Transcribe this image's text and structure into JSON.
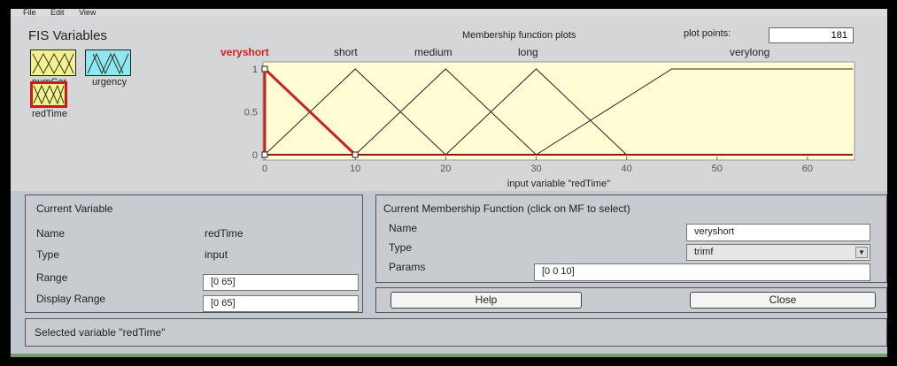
{
  "menu": [
    "File",
    "Edit",
    "View"
  ],
  "fis_variables": {
    "title": "FIS Variables",
    "inputs": [
      "numCar",
      "urgency"
    ],
    "output": "redTime"
  },
  "plot": {
    "title": "Membership function plots",
    "plot_points_label": "plot points:",
    "plot_points_value": "181",
    "xlabel": "input variable \"redTime\"",
    "x_ticks": [
      "0",
      "10",
      "20",
      "30",
      "40",
      "50",
      "60"
    ],
    "y_ticks": [
      "0",
      "0.5",
      "1"
    ],
    "mf_names": [
      "veryshort",
      "short",
      "medium",
      "long",
      "verylong"
    ],
    "selected_mf_color": "#cc2222"
  },
  "chart_data": {
    "type": "line",
    "xlabel": "input variable \"redTime\"",
    "xlim": [
      0,
      65
    ],
    "ylim": [
      0,
      1
    ],
    "series": [
      {
        "name": "veryshort",
        "x": [
          0,
          0,
          10
        ],
        "y": [
          0,
          1,
          0
        ],
        "color": "#cc2222"
      },
      {
        "name": "short",
        "x": [
          0,
          10,
          20
        ],
        "y": [
          0,
          1,
          0
        ],
        "color": "#222222"
      },
      {
        "name": "medium",
        "x": [
          10,
          20,
          30
        ],
        "y": [
          0,
          1,
          0
        ],
        "color": "#222222"
      },
      {
        "name": "long",
        "x": [
          20,
          30,
          40
        ],
        "y": [
          0,
          1,
          0
        ],
        "color": "#222222"
      },
      {
        "name": "verylong",
        "x": [
          30,
          45,
          65
        ],
        "y": [
          0,
          1,
          1
        ],
        "color": "#222222"
      }
    ]
  },
  "current_variable": {
    "title": "Current Variable",
    "name_label": "Name",
    "name_value": "redTime",
    "type_label": "Type",
    "type_value": "input",
    "range_label": "Range",
    "range_value": "[0 65]",
    "display_range_label": "Display Range",
    "display_range_value": "[0 65]"
  },
  "current_mf": {
    "title": "Current Membership Function (click on MF to select)",
    "name_label": "Name",
    "name_value": "veryshort",
    "type_label": "Type",
    "type_value": "trimf",
    "params_label": "Params",
    "params_value": "[0 0 10]"
  },
  "buttons": {
    "help": "Help",
    "close": "Close"
  },
  "status": "Selected variable \"redTime\""
}
